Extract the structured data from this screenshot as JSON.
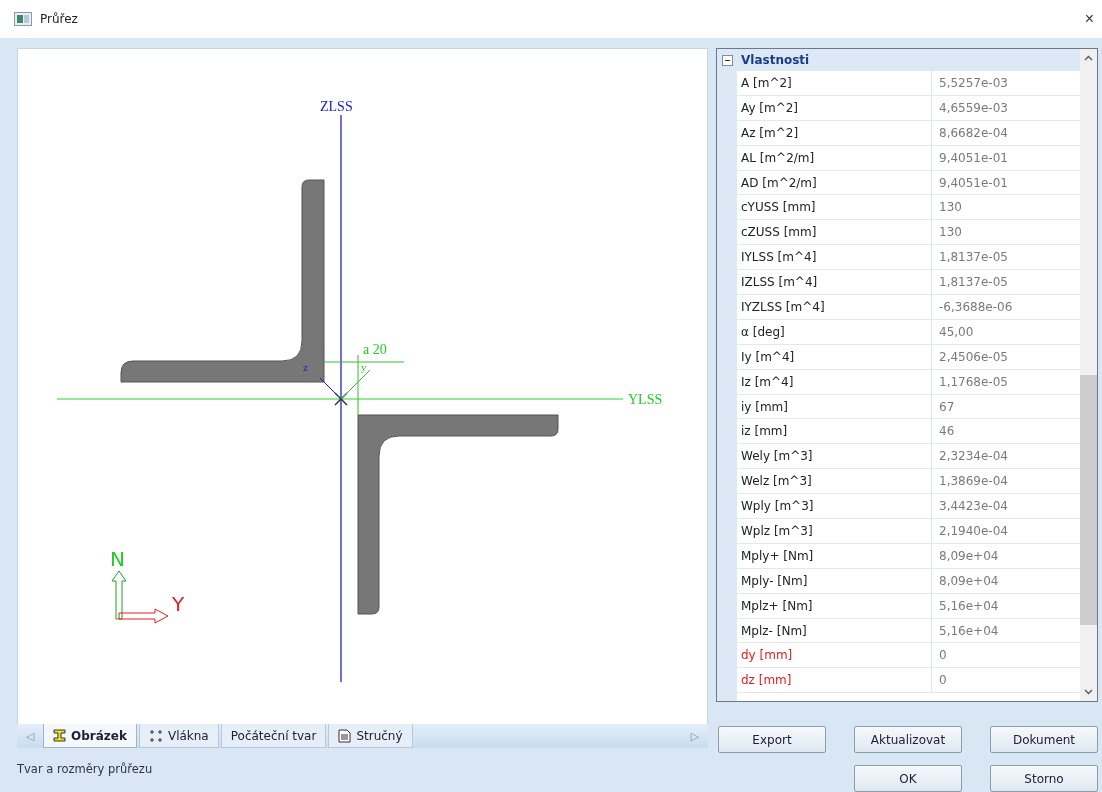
{
  "window": {
    "title": "Průřez",
    "close": "×"
  },
  "drawing": {
    "z_axis": "ZLSS",
    "y_axis": "YLSS",
    "dimension": "a 20",
    "local_z": "z",
    "local_y": "y",
    "north": "N",
    "east": "Y"
  },
  "tabs": [
    {
      "label": "Obrázek",
      "kind": "section",
      "selected": true
    },
    {
      "label": "Vlákna",
      "kind": "fibers",
      "selected": false
    },
    {
      "label": "Počáteční tvar",
      "kind": "plain",
      "selected": false
    },
    {
      "label": "Stručný",
      "kind": "summary",
      "selected": false
    }
  ],
  "tab_scroll": {
    "left": "◁",
    "right": "▷"
  },
  "status_bar": "Tvar a rozměry průřezu",
  "properties": {
    "title": "Vlastnosti",
    "expanded": true,
    "rows": [
      {
        "name": "A [m^2]",
        "value": "5,5257e-03",
        "flagged": false
      },
      {
        "name": "Ay [m^2]",
        "value": "4,6559e-03",
        "flagged": false
      },
      {
        "name": "Az [m^2]",
        "value": "8,6682e-04",
        "flagged": false
      },
      {
        "name": "AL [m^2/m]",
        "value": "9,4051e-01",
        "flagged": false
      },
      {
        "name": "AD [m^2/m]",
        "value": "9,4051e-01",
        "flagged": false
      },
      {
        "name": "cYUSS [mm]",
        "value": "130",
        "flagged": false
      },
      {
        "name": "cZUSS [mm]",
        "value": "130",
        "flagged": false
      },
      {
        "name": "IYLSS [m^4]",
        "value": "1,8137e-05",
        "flagged": false
      },
      {
        "name": "IZLSS [m^4]",
        "value": "1,8137e-05",
        "flagged": false
      },
      {
        "name": "IYZLSS [m^4]",
        "value": "-6,3688e-06",
        "flagged": false
      },
      {
        "name": "α [deg]",
        "value": "45,00",
        "flagged": false
      },
      {
        "name": "Iy [m^4]",
        "value": "2,4506e-05",
        "flagged": false
      },
      {
        "name": "Iz [m^4]",
        "value": "1,1768e-05",
        "flagged": false
      },
      {
        "name": "iy [mm]",
        "value": "67",
        "flagged": false
      },
      {
        "name": "iz [mm]",
        "value": "46",
        "flagged": false
      },
      {
        "name": "Wely [m^3]",
        "value": "2,3234e-04",
        "flagged": false
      },
      {
        "name": "Welz [m^3]",
        "value": "1,3869e-04",
        "flagged": false
      },
      {
        "name": "Wply [m^3]",
        "value": "3,4423e-04",
        "flagged": false
      },
      {
        "name": "Wplz [m^3]",
        "value": "2,1940e-04",
        "flagged": false
      },
      {
        "name": "Mply+ [Nm]",
        "value": "8,09e+04",
        "flagged": false
      },
      {
        "name": "Mply- [Nm]",
        "value": "8,09e+04",
        "flagged": false
      },
      {
        "name": "Mplz+ [Nm]",
        "value": "5,16e+04",
        "flagged": false
      },
      {
        "name": "Mplz- [Nm]",
        "value": "5,16e+04",
        "flagged": false
      },
      {
        "name": "dy [mm]",
        "value": "0",
        "flagged": true
      },
      {
        "name": "dz [mm]",
        "value": "0",
        "flagged": true
      }
    ]
  },
  "buttons": [
    [
      "Export",
      "Aktualizovat",
      "Dokument"
    ],
    [
      "OK",
      "Storno"
    ]
  ]
}
